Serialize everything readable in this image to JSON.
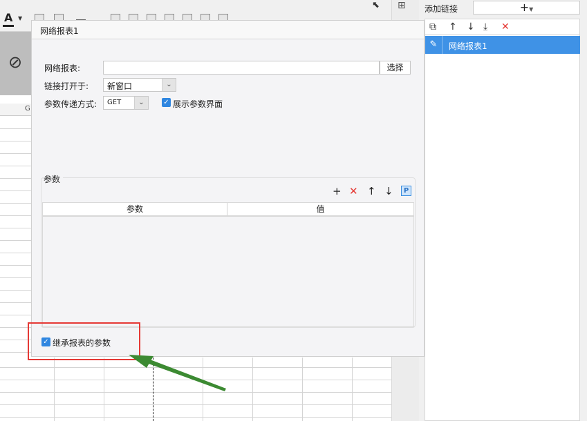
{
  "toolbar": {
    "font_color_glyph": "A"
  },
  "sheet": {
    "column_label": "G"
  },
  "dialog": {
    "tab_title": "网络报表1",
    "report_label": "网络报表:",
    "report_value": "",
    "choose_button": "选择",
    "open_in_label": "链接打开于:",
    "open_in_value": "新窗口",
    "method_label": "参数传递方式:",
    "method_value": "GET",
    "show_param_label": "展示参数界面",
    "show_param_checked": true,
    "param_section_title": "参数",
    "param_columns": [
      "参数",
      "值"
    ],
    "param_rows": [],
    "inherit_label": "继承报表的参数",
    "inherit_checked": true
  },
  "link_panel": {
    "add_link_label": "添加链接",
    "add_button_glyph": "+",
    "items": [
      {
        "label": "网络报表1",
        "selected": true
      }
    ]
  },
  "icons": {
    "copy": "copy-icon",
    "up": "arrow-up-icon",
    "down": "arrow-down-icon",
    "delete": "delete-icon",
    "param": "P"
  },
  "colors": {
    "accent": "#3f92e6",
    "checkbox": "#2f86e0",
    "delete": "#e53935",
    "annotation_box": "#e53935",
    "annotation_arrow": "#3c8a32"
  }
}
